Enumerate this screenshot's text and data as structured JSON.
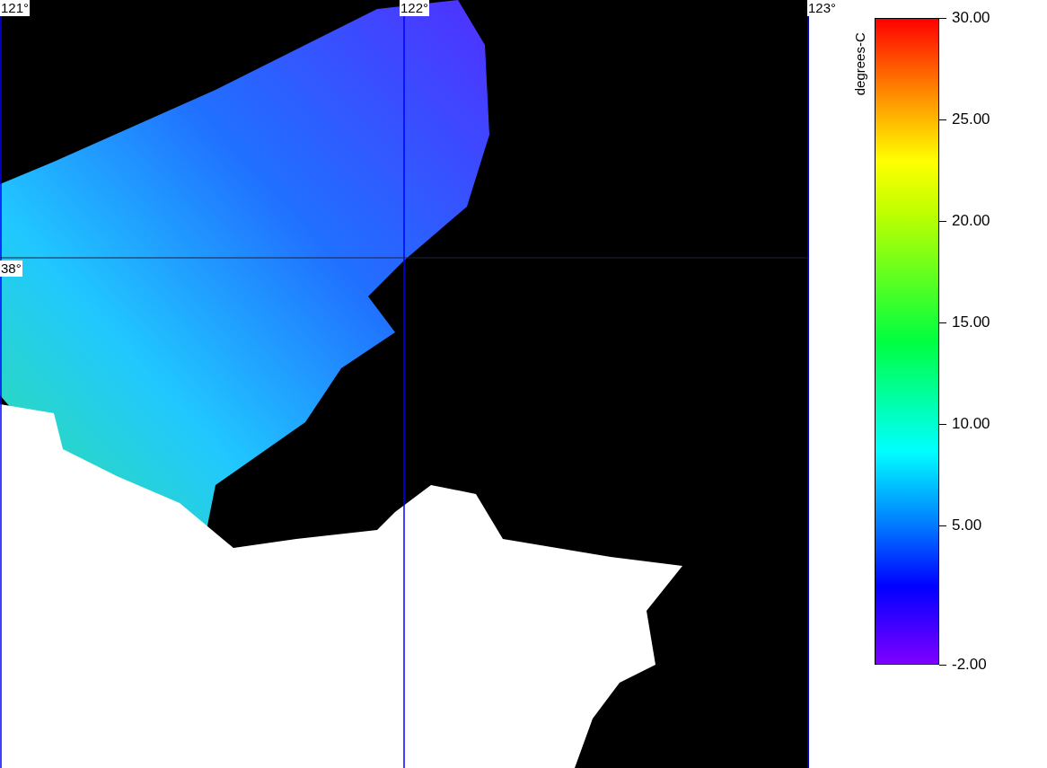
{
  "map": {
    "longitude_labels": [
      "121°",
      "122°",
      "123°"
    ],
    "latitude_labels": [
      "38°"
    ]
  },
  "legend": {
    "title": "degrees-C",
    "ticks": [
      "30.00",
      "25.00",
      "20.00",
      "15.00",
      "10.00",
      "5.00",
      "-2.00"
    ]
  }
}
